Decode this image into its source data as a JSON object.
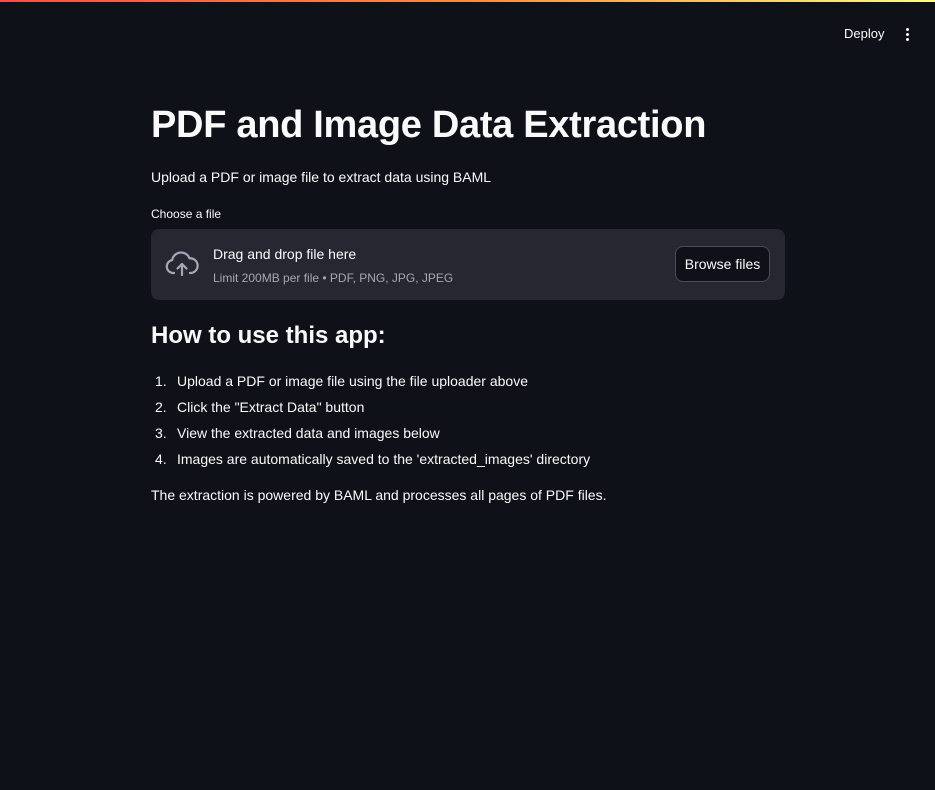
{
  "header": {
    "deploy_label": "Deploy",
    "menu_icon": "kebab-menu-icon"
  },
  "main": {
    "title": "PDF and Image Data Extraction",
    "subtitle": "Upload a PDF or image file to extract data using BAML",
    "uploader": {
      "label": "Choose a file",
      "icon": "cloud-upload-icon",
      "drop_text": "Drag and drop file here",
      "limit_text": "Limit 200MB per file • PDF, PNG, JPG, JPEG",
      "browse_label": "Browse files"
    },
    "howto": {
      "title": "How to use this app:",
      "steps": [
        {
          "num": "1.",
          "text": "Upload a PDF or image file using the file uploader above"
        },
        {
          "num": "2.",
          "text": "Click the \"Extract Data\" button"
        },
        {
          "num": "3.",
          "text": "View the extracted data and images below"
        },
        {
          "num": "4.",
          "text": "Images are automatically saved to the 'extracted_images' directory"
        }
      ]
    },
    "footer": "The extraction is powered by BAML and processes all pages of PDF files."
  },
  "colors": {
    "background": "#0e1117",
    "dropzone": "#262730",
    "text": "#fafafa",
    "muted": "#a3a8b8",
    "accent_gradient_start": "#ff4b4b",
    "accent_gradient_end": "#fffd80"
  }
}
